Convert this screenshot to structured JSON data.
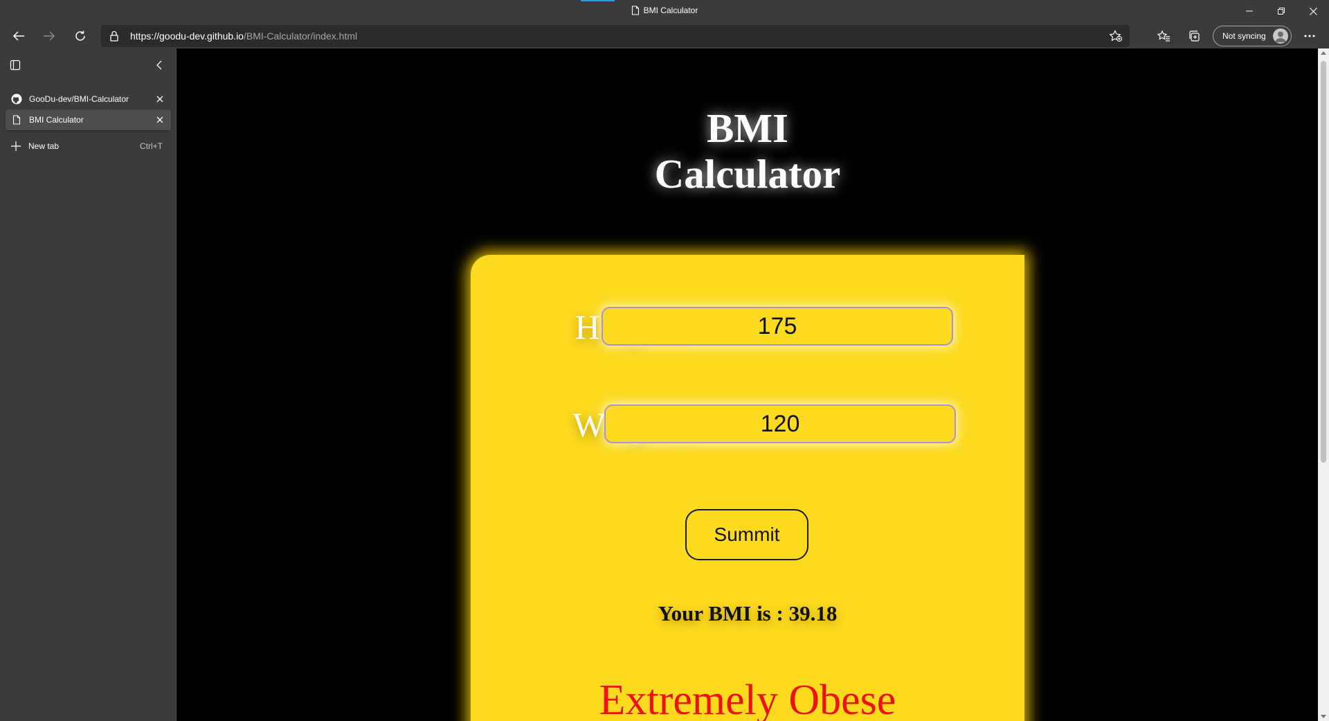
{
  "window": {
    "title": "BMI Calculator",
    "controls": [
      "minimize",
      "restore",
      "close"
    ]
  },
  "toolbar": {
    "url_host": "https://goodu-dev.github.io",
    "url_path": "/BMI-Calculator/index.html",
    "sync_label": "Not syncing"
  },
  "sidebar": {
    "tabs": [
      {
        "title": "GooDu-dev/BMI-Calculator",
        "icon": "github-icon",
        "active": false
      },
      {
        "title": "BMI Calculator",
        "icon": "page-icon",
        "active": true
      }
    ],
    "new_tab_label": "New tab",
    "new_tab_shortcut": "Ctrl+T"
  },
  "page": {
    "title_line1": "BMI",
    "title_line2": "Calculator",
    "height_label": "Height :",
    "height_value": "175",
    "weight_label": "Weight :",
    "weight_value": "120",
    "submit_label": "Summit",
    "result_text": "Your BMI is : 39.18",
    "category_text": "Extremely Obese"
  },
  "colors": {
    "card_background": "#fcda1f",
    "card_glow": "#ffd60a",
    "page_background": "#000000",
    "category_text": "#ee1111",
    "browser_chrome": "#3b3b3b"
  }
}
